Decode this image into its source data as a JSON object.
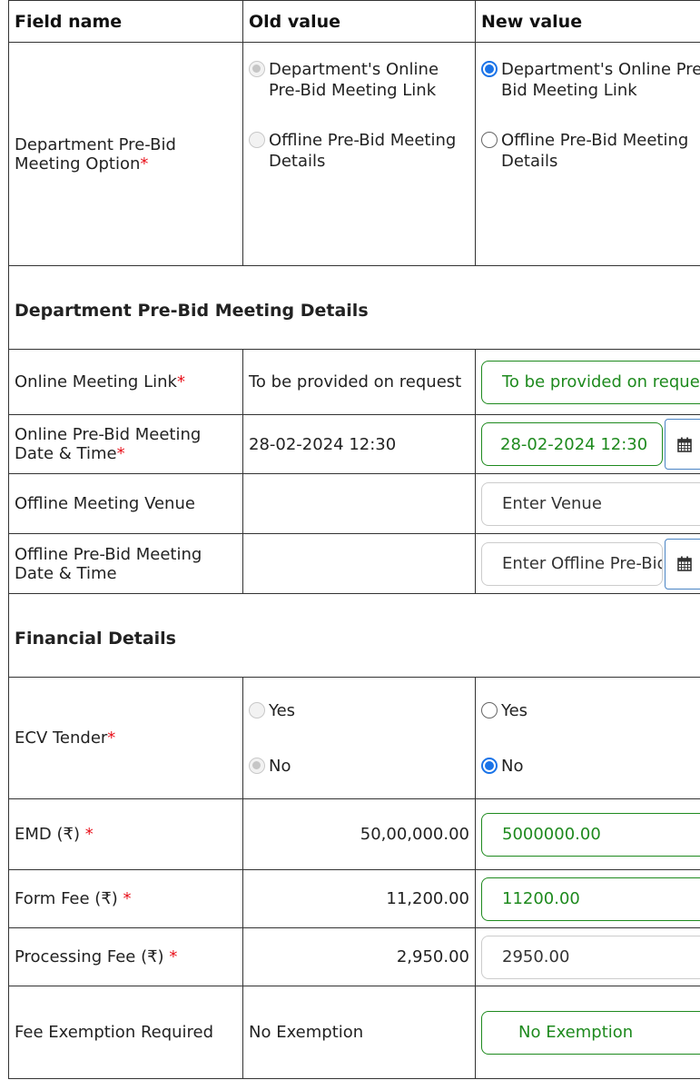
{
  "headers": {
    "field": "Field name",
    "old": "Old value",
    "new": "New value"
  },
  "pre_bid_option": {
    "label": "Department Pre-Bid Meeting Option",
    "required_mark": "*",
    "option_online": "Department's Online Pre-Bid Meeting Link",
    "option_offline": "Offline Pre-Bid Meeting Details",
    "old_selected": "online",
    "new_selected": "online"
  },
  "section_pre_bid": "Department Pre-Bid Meeting Details",
  "online_link": {
    "label": "Online Meeting Link",
    "required_mark": "*",
    "old": "To be provided on request",
    "new": "To be provided on request"
  },
  "online_datetime": {
    "label": "Online Pre-Bid Meeting Date & Time",
    "required_mark": "*",
    "old": "28-02-2024 12:30",
    "new": "28-02-2024 12:30"
  },
  "offline_venue": {
    "label": "Offline Meeting Venue",
    "old": "",
    "placeholder": "Enter Venue"
  },
  "offline_datetime": {
    "label": "Offline Pre-Bid Meeting Date & Time",
    "old": "",
    "placeholder": "Enter Offline Pre-Bid Meeting Date & Time"
  },
  "section_financial": "Financial Details",
  "ecv": {
    "label": "ECV Tender",
    "required_mark": "*",
    "yes": "Yes",
    "no": "No",
    "old_selected": "no",
    "new_selected": "no"
  },
  "emd": {
    "label": "EMD (₹)",
    "required_mark": "*",
    "old": "50,00,000.00",
    "new": "5000000.00"
  },
  "form_fee": {
    "label": "Form Fee (₹)",
    "required_mark": "*",
    "old": "11,200.00",
    "new": "11200.00"
  },
  "processing_fee": {
    "label": "Processing Fee (₹)",
    "required_mark": "*",
    "old": "2,950.00",
    "new": "2950.00"
  },
  "fee_exemption": {
    "label": "Fee Exemption Required",
    "old": "No Exemption",
    "new": "No Exemption"
  },
  "icons": {
    "calendar": "calendar-icon",
    "dropdown": "chevron-down-icon"
  },
  "colors": {
    "required": "#e8111b",
    "changed_border": "#1e8a1e",
    "radio_selected": "#1a73e8",
    "calendar_border": "#4a84c4"
  }
}
